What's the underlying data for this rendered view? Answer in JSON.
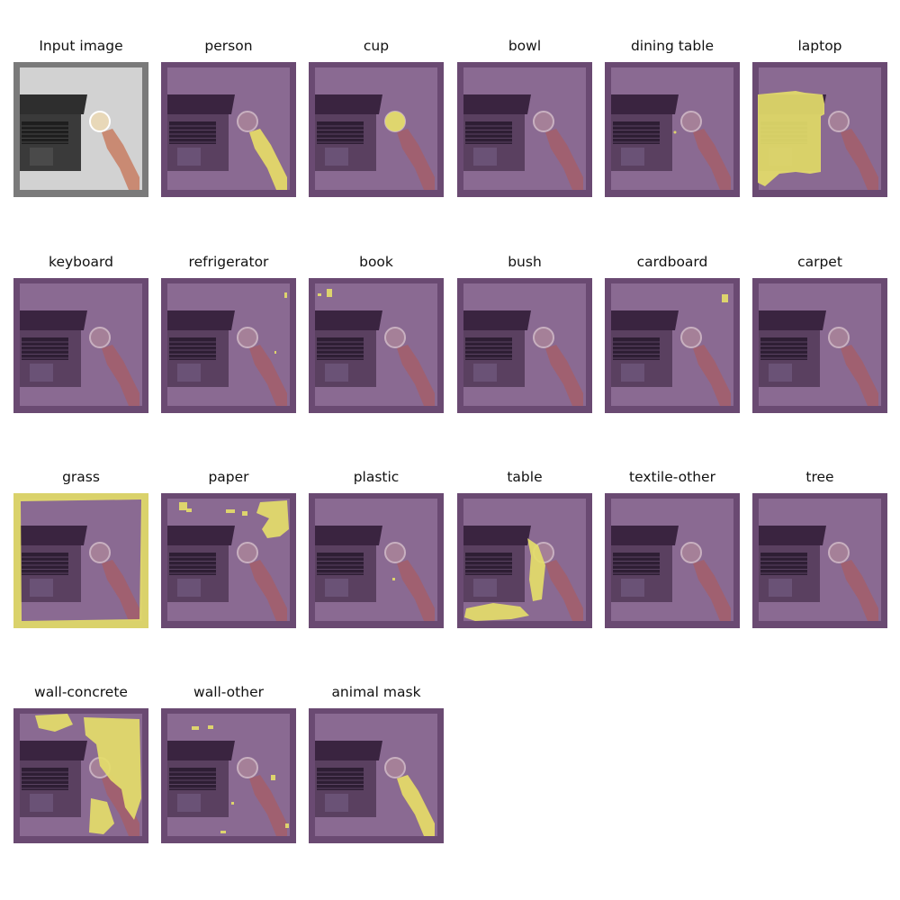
{
  "figure": {
    "panels": [
      {
        "title": "Input image",
        "kind": "input"
      },
      {
        "title": "person",
        "kind": "mask",
        "mask": "person"
      },
      {
        "title": "cup",
        "kind": "mask",
        "mask": "cup"
      },
      {
        "title": "bowl",
        "kind": "mask",
        "mask": "none"
      },
      {
        "title": "dining table",
        "kind": "mask",
        "mask": "dining"
      },
      {
        "title": "laptop",
        "kind": "mask",
        "mask": "laptop"
      },
      {
        "title": "keyboard",
        "kind": "mask",
        "mask": "none"
      },
      {
        "title": "refrigerator",
        "kind": "mask",
        "mask": "fridge"
      },
      {
        "title": "book",
        "kind": "mask",
        "mask": "book"
      },
      {
        "title": "bush",
        "kind": "mask",
        "mask": "none"
      },
      {
        "title": "cardboard",
        "kind": "mask",
        "mask": "cardboard"
      },
      {
        "title": "carpet",
        "kind": "mask",
        "mask": "none"
      },
      {
        "title": "grass",
        "kind": "mask",
        "mask": "grass"
      },
      {
        "title": "paper",
        "kind": "mask",
        "mask": "paper"
      },
      {
        "title": "plastic",
        "kind": "mask",
        "mask": "plastic"
      },
      {
        "title": "table",
        "kind": "mask",
        "mask": "table"
      },
      {
        "title": "textile-other",
        "kind": "mask",
        "mask": "none"
      },
      {
        "title": "tree",
        "kind": "mask",
        "mask": "none"
      },
      {
        "title": "wall-concrete",
        "kind": "mask",
        "mask": "wallconcrete"
      },
      {
        "title": "wall-other",
        "kind": "mask",
        "mask": "wallother"
      },
      {
        "title": "animal mask",
        "kind": "mask",
        "mask": "person"
      }
    ],
    "colors": {
      "mask_tint": "#8a6a92",
      "mask_border": "#6a4a72",
      "highlight": "#e4dd6a",
      "input_background": "#d2d2d2",
      "input_border": "#7a7a7a",
      "laptop_dark": "#3a3a3a",
      "skin": "#c98a73"
    }
  }
}
